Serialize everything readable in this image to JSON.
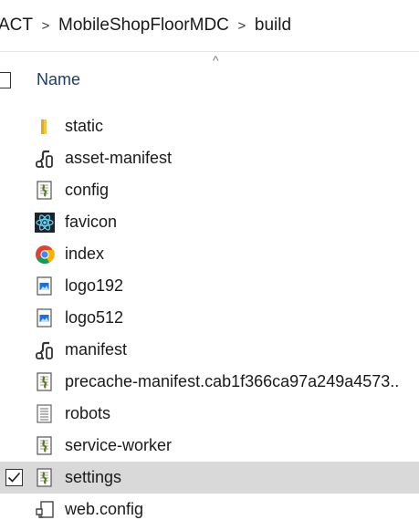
{
  "breadcrumb": {
    "items": [
      "ACT",
      "MobileShopFloorMDC",
      "build"
    ],
    "separator": ">"
  },
  "header": {
    "sort_indicator": "^",
    "name_label": "Name"
  },
  "files": [
    {
      "name": "static",
      "icon": "folder-icon",
      "selected": false
    },
    {
      "name": "asset-manifest",
      "icon": "json-file-icon",
      "selected": false
    },
    {
      "name": "config",
      "icon": "script-file-icon",
      "selected": false
    },
    {
      "name": "favicon",
      "icon": "react-icon",
      "selected": false
    },
    {
      "name": "index",
      "icon": "chrome-icon",
      "selected": false
    },
    {
      "name": "logo192",
      "icon": "image-file-icon",
      "selected": false
    },
    {
      "name": "logo512",
      "icon": "image-file-icon",
      "selected": false
    },
    {
      "name": "manifest",
      "icon": "json-file-icon",
      "selected": false
    },
    {
      "name": "precache-manifest.cab1f366ca97a249a4573..",
      "icon": "script-file-icon",
      "selected": false
    },
    {
      "name": "robots",
      "icon": "text-file-icon",
      "selected": false
    },
    {
      "name": "service-worker",
      "icon": "script-file-icon",
      "selected": false
    },
    {
      "name": "settings",
      "icon": "script-file-icon",
      "selected": true
    },
    {
      "name": "web.config",
      "icon": "config-file-icon",
      "selected": false
    }
  ],
  "colors": {
    "folder": "#f4c542",
    "selection": "#d9d9d9",
    "react": "#61dafb",
    "header_text": "#1e3d6b"
  }
}
